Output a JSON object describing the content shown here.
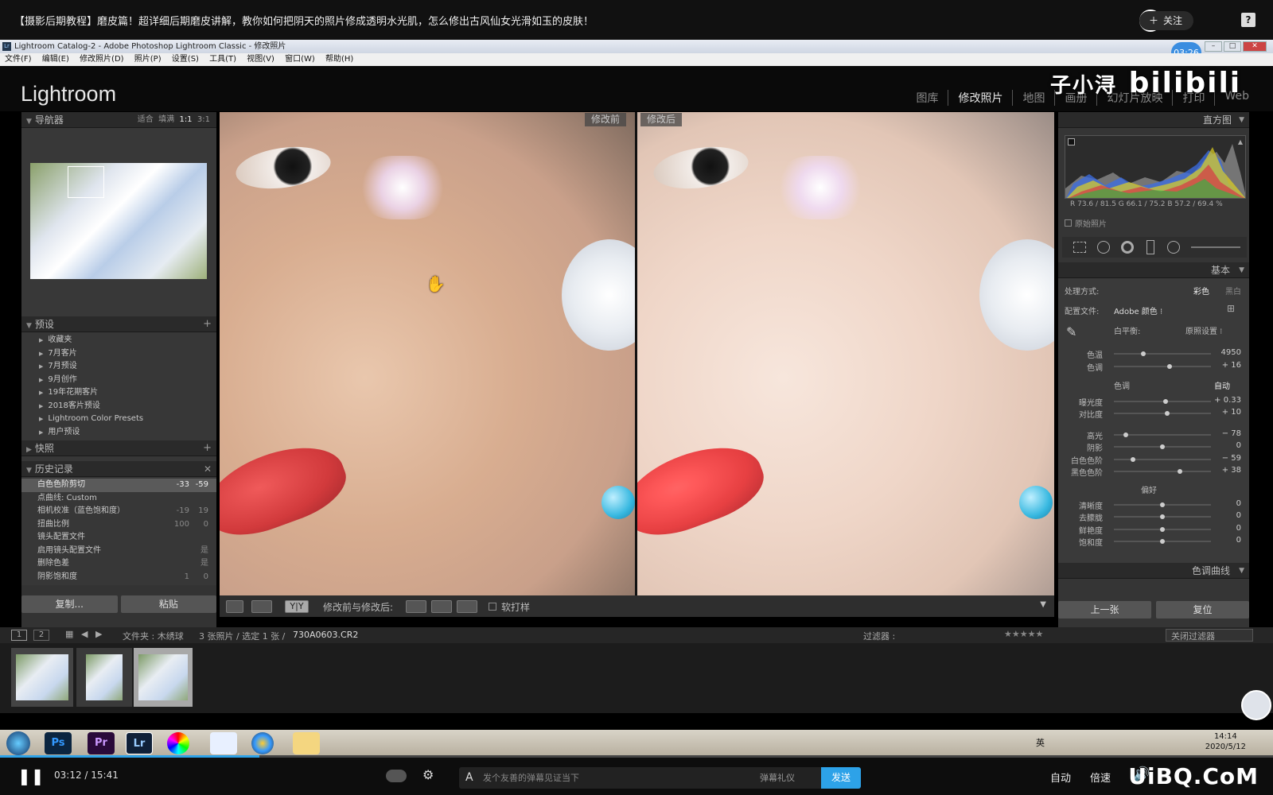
{
  "video": {
    "title": "【摄影后期教程】磨皮篇！超详细后期磨皮讲解，教你如何把阴天的照片修成透明水光肌，怎么修出古风仙女光滑如玉的皮肤！",
    "follow_label": "关注",
    "help": "?",
    "time_bubble": "03:26",
    "current_time": "03:12",
    "duration": "15:41",
    "progress": 0.204,
    "danmu_placeholder": "发个友善的弹幕见证当下",
    "danmu_etiquette": "弹幕礼仪",
    "send": "发送",
    "auto": "自动",
    "speed": "倍速",
    "watermark_channel": "子小浔",
    "watermark_site": "bilibili",
    "corner_watermark": "UiBQ.CoM"
  },
  "window": {
    "title": "Lightroom Catalog-2 - Adobe Photoshop Lightroom Classic - 修改照片",
    "menu": [
      "文件(F)",
      "编辑(E)",
      "修改照片(D)",
      "照片(P)",
      "设置(S)",
      "工具(T)",
      "视图(V)",
      "窗口(W)",
      "帮助(H)"
    ]
  },
  "lightroom": {
    "logo": "Lightroom",
    "modules": [
      "图库",
      "修改照片",
      "地图",
      "画册",
      "幻灯片放映",
      "打印",
      "Web"
    ],
    "active_module": "修改照片"
  },
  "left": {
    "navigator": {
      "title": "导航器",
      "zoom": [
        "适合",
        "填满",
        "1:1",
        "3:1"
      ]
    },
    "presets": {
      "title": "预设",
      "items": [
        "收藏夹",
        "7月客片",
        "7月预设",
        "9月创作",
        "19年花期客片",
        "2018客片预设",
        "Lightroom Color Presets",
        "用户预设"
      ]
    },
    "snapshots": {
      "title": "快照"
    },
    "history": {
      "title": "历史记录",
      "items": [
        {
          "name": "白色色阶剪切",
          "a": "-33",
          "b": "-59"
        },
        {
          "name": "点曲线: Custom",
          "a": "",
          "b": ""
        },
        {
          "name": "相机校准（蓝色饱和度）",
          "a": "-19",
          "b": "19"
        },
        {
          "name": "扭曲比例",
          "a": "100",
          "b": "0"
        },
        {
          "name": "镜头配置文件",
          "a": "",
          "b": ""
        },
        {
          "name": "启用镜头配置文件",
          "a": "",
          "b": "是"
        },
        {
          "name": "删除色差",
          "a": "",
          "b": "是"
        },
        {
          "name": "阴影饱和度",
          "a": "1",
          "b": "0"
        }
      ]
    },
    "copy": "复制...",
    "paste": "粘贴"
  },
  "center": {
    "before_label": "修改前",
    "after_label": "修改后",
    "toolbar_label": "修改前与修改后:",
    "soft_proof": "软打样",
    "yy": "Y|Y"
  },
  "right": {
    "histogram_title": "直方图",
    "rgb": "R 73.6 / 81.5   G 66.1 / 75.2   B 57.2 / 69.4 %",
    "original_photo": "原始照片",
    "basic_title": "基本",
    "treatment_label": "处理方式:",
    "color": "彩色",
    "bw": "黑白",
    "profile_label": "配置文件:",
    "profile_value": "Adobe 颜色 ⁝",
    "wb_label": "白平衡:",
    "wb_value": "原照设置 ⁝",
    "tone_label": "色调",
    "auto": "自动",
    "presence_label": "偏好",
    "sliders": [
      {
        "name": "色温",
        "value": "4950",
        "pos": 0.3
      },
      {
        "name": "色调",
        "value": "+ 16",
        "pos": 0.57
      },
      {
        "name": "曝光度",
        "value": "+ 0.33",
        "pos": 0.53
      },
      {
        "name": "对比度",
        "value": "+ 10",
        "pos": 0.55
      },
      {
        "name": "高光",
        "value": "− 78",
        "pos": 0.12
      },
      {
        "name": "阴影",
        "value": "0",
        "pos": 0.5
      },
      {
        "name": "白色色阶",
        "value": "− 59",
        "pos": 0.2
      },
      {
        "name": "黑色色阶",
        "value": "+ 38",
        "pos": 0.68
      },
      {
        "name": "清晰度",
        "value": "0",
        "pos": 0.5
      },
      {
        "name": "去朦胧",
        "value": "0",
        "pos": 0.5
      },
      {
        "name": "鲜艳度",
        "value": "0",
        "pos": 0.5
      },
      {
        "name": "饱和度",
        "value": "0",
        "pos": 0.5
      }
    ],
    "tone_curve_title": "色调曲线",
    "prev": "上一张",
    "reset": "复位"
  },
  "filmstrip": {
    "pages": [
      "1",
      "2"
    ],
    "source": "文件夹 : 木绣球",
    "count": "3 张照片 / 选定 1 张 /",
    "file": "730A0603.CR2",
    "filter_label": "过滤器 :",
    "filter_value": "关闭过滤器"
  },
  "taskbar": {
    "apps": [
      "Ps",
      "Pr",
      "Lr"
    ],
    "time": "14:14",
    "date": "2020/5/12",
    "lang": "英"
  },
  "colors": {
    "accent": "#2da2e8",
    "lr_bg": "#0a0a0a",
    "panel": "#353535"
  }
}
